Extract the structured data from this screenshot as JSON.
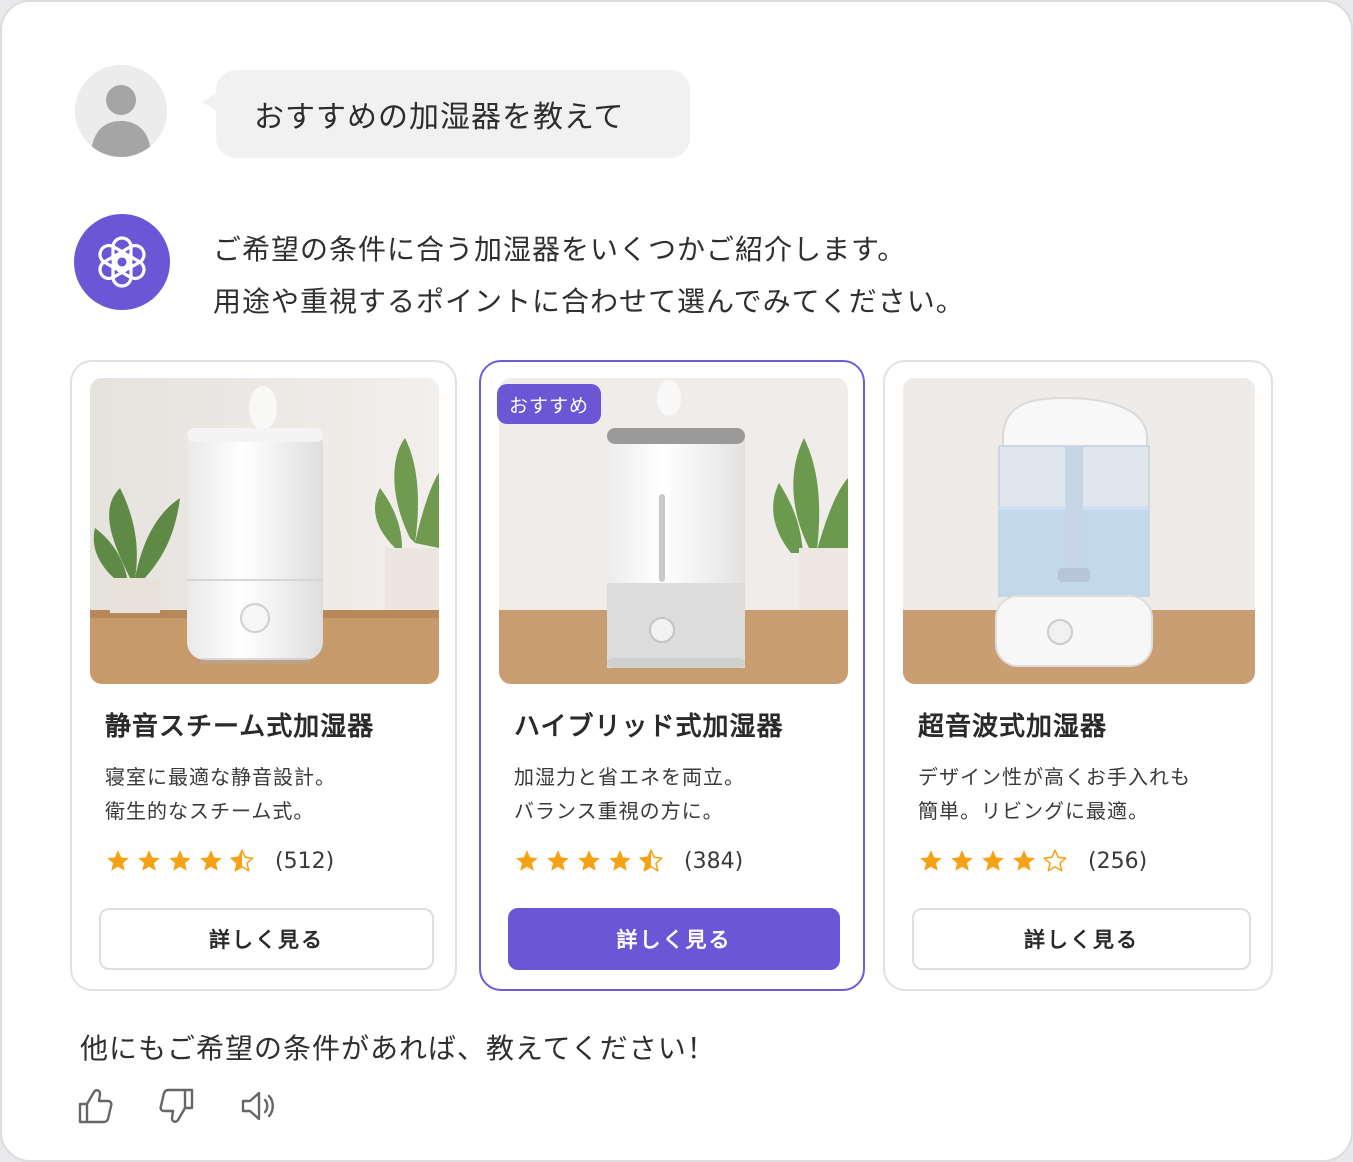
{
  "user_message": "おすすめの加湿器を教えて",
  "assistant": {
    "intro_line1": "ご希望の条件に合う加湿器をいくつかご紹介します。",
    "intro_line2": "用途や重視するポイントに合わせて選んでみてください。",
    "footer": "他にもご希望の条件があれば、教えてください！"
  },
  "accent_color": "#6b57d6",
  "star_color": "#f5a216",
  "cards": [
    {
      "title": "静音スチーム式加湿器",
      "desc_line1": "寝室に最適な静音設計。",
      "desc_line2": "衛生的なスチーム式。",
      "rating": 4.5,
      "rating_count": "(512)",
      "button_label": "詳しく見る",
      "featured": false
    },
    {
      "title": "ハイブリッド式加湿器",
      "desc_line1": "加湿力と省エネを両立。",
      "desc_line2": "バランス重視の方に。",
      "rating": 4.5,
      "rating_count": "(384)",
      "button_label": "詳しく見る",
      "featured": true,
      "badge": "おすすめ"
    },
    {
      "title": "超音波式加湿器",
      "desc_line1": "デザイン性が高くお手入れも",
      "desc_line2": "簡単。リビングに最適。",
      "rating": 4,
      "rating_count": "(256)",
      "button_label": "詳しく見る",
      "featured": false
    }
  ],
  "action_icons": [
    "thumbs-up-icon",
    "thumbs-down-icon",
    "speaker-icon"
  ]
}
